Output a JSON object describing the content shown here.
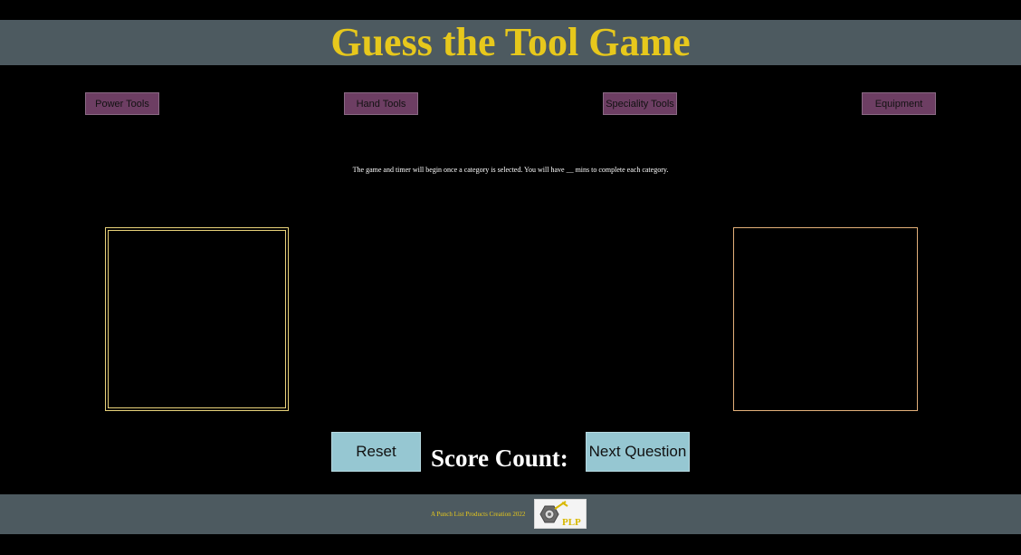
{
  "header": {
    "title": "Guess the Tool Game"
  },
  "categories": [
    {
      "label": "Power Tools"
    },
    {
      "label": "Hand Tools"
    },
    {
      "label": "Speciality Tools"
    },
    {
      "label": "Equipment"
    }
  ],
  "instructions": "The game and timer will begin once a category is selected. You will have __ mins to complete each category.",
  "controls": {
    "reset_label": "Reset",
    "score_label": "Score Count:",
    "next_label": "Next Question"
  },
  "footer": {
    "credit": "A Punch List Products Creation 2022",
    "logo_text": "PLP"
  },
  "colors": {
    "accent_yellow": "#e7c81c",
    "header_bg": "#4d5a60",
    "category_bg": "#6d3e63",
    "action_bg": "#96c7d2"
  }
}
